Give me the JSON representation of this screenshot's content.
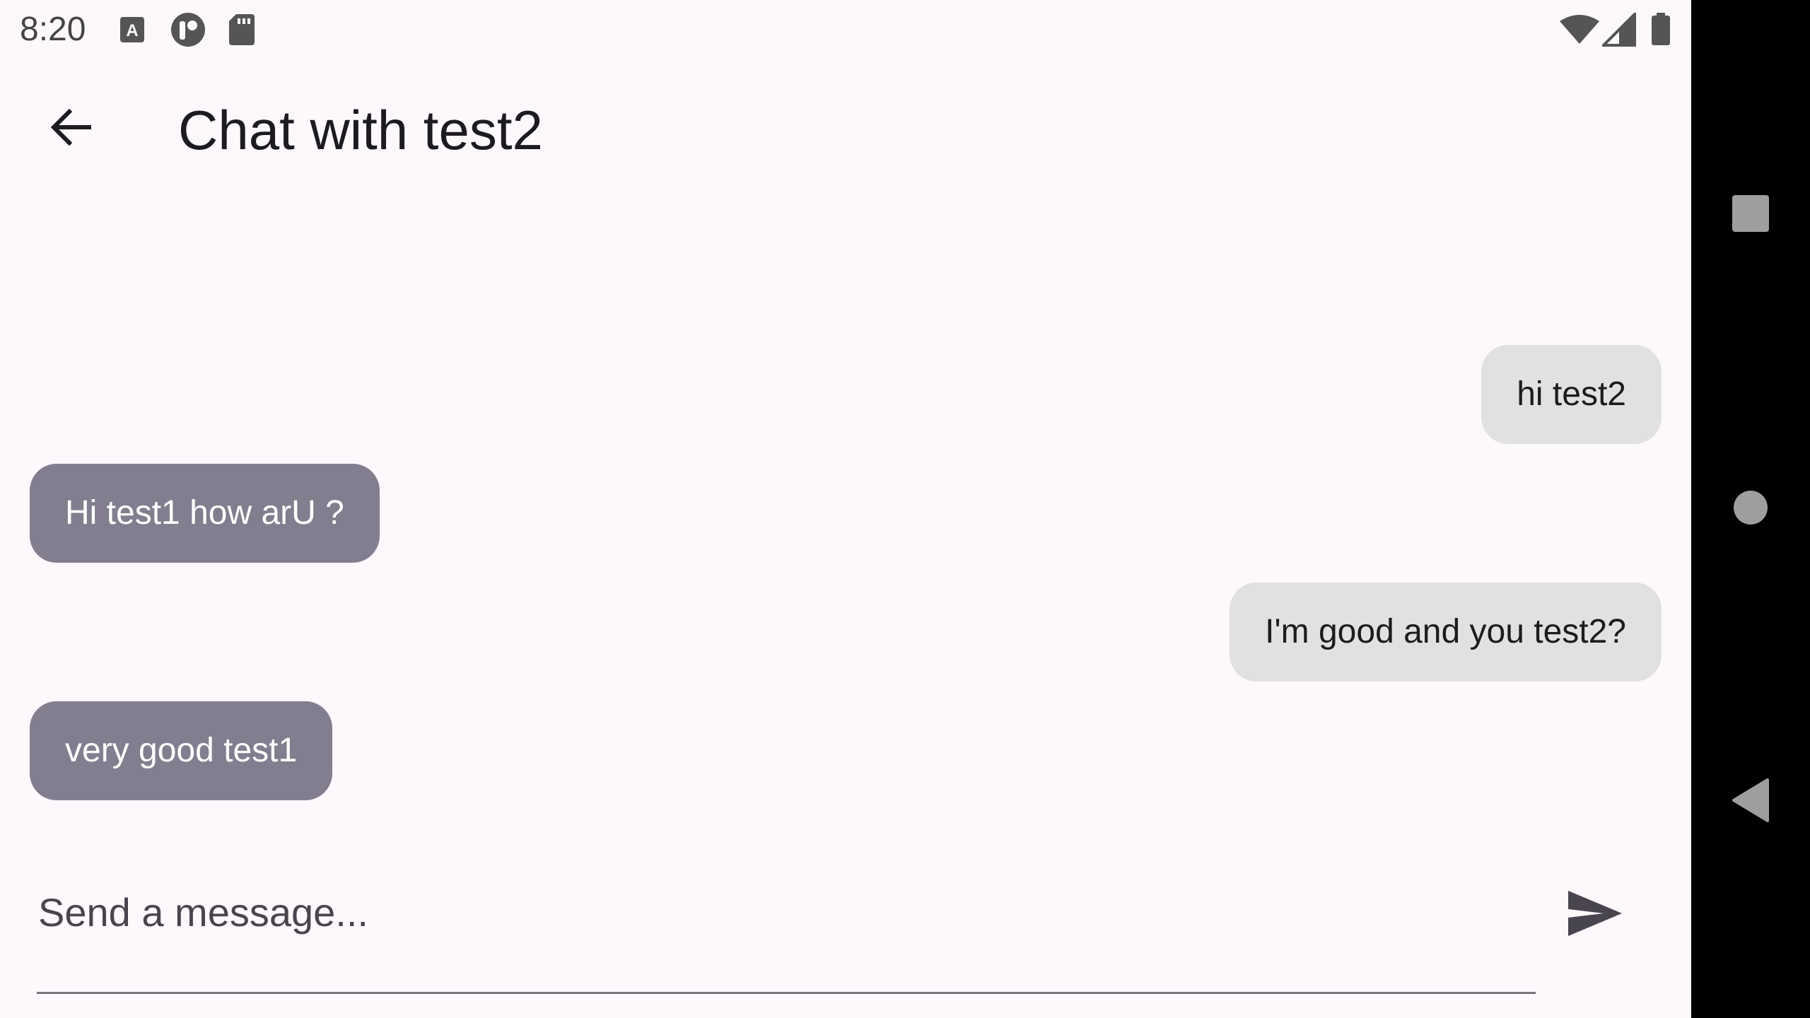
{
  "status_bar": {
    "time": "8:20",
    "notification_icons": [
      "keyboard-a-icon",
      "app-circle-icon",
      "sd-card-icon"
    ],
    "system_icons": [
      "wifi-icon",
      "cellular-signal-icon",
      "battery-icon"
    ]
  },
  "app_bar": {
    "title": "Chat with test2",
    "back_icon": "arrow-back-icon"
  },
  "messages": [
    {
      "text": "hi test2",
      "direction": "sent"
    },
    {
      "text": "Hi test1 how arU ?",
      "direction": "received"
    },
    {
      "text": "I'm good and you test2?",
      "direction": "sent"
    },
    {
      "text": "very good test1",
      "direction": "received"
    }
  ],
  "composer": {
    "placeholder": "Send a message...",
    "value": "",
    "send_icon": "send-icon"
  },
  "nav_bar": {
    "buttons": [
      "recents-square-icon",
      "home-circle-icon",
      "back-triangle-icon"
    ]
  },
  "colors": {
    "background": "#fdf8fc",
    "sent_bubble": "#e1e1e1",
    "received_bubble": "#837e8f",
    "nav_bar": "#000000"
  }
}
